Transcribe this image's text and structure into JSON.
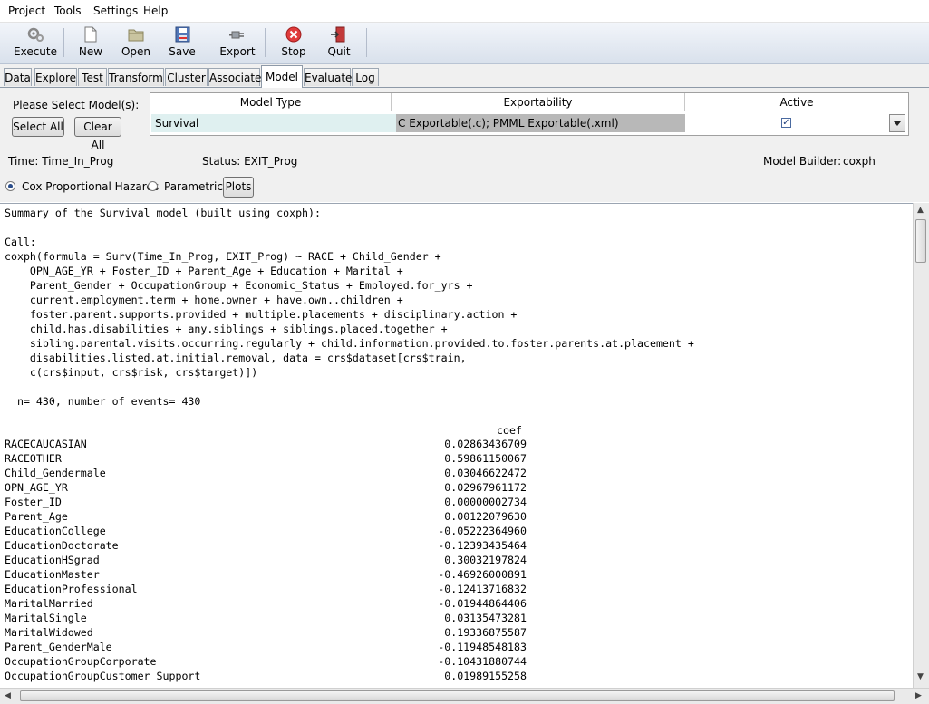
{
  "menu": [
    "Project",
    "Tools",
    "Settings",
    "Help"
  ],
  "toolbar": {
    "execute": "Execute",
    "new": "New",
    "open": "Open",
    "save": "Save",
    "export": "Export",
    "stop": "Stop",
    "quit": "Quit"
  },
  "tabs": [
    "Data",
    "Explore",
    "Test",
    "Transform",
    "Cluster",
    "Associate",
    "Model",
    "Evaluate",
    "Log"
  ],
  "active_tab": "Model",
  "model_select": {
    "prompt": "Please Select Model(s):",
    "select_all": "Select All",
    "clear_all": "Clear All"
  },
  "model_grid": {
    "headers": [
      "Model Type",
      "Exportability",
      "Active"
    ],
    "row": {
      "type": "Survival",
      "exportability": "C Exportable(.c); PMML Exportable(.xml)",
      "active": true
    }
  },
  "status": {
    "time": "Time: Time_In_Prog",
    "status": "Status: EXIT_Prog",
    "builder_label": "Model Builder:",
    "builder_value": "coxph"
  },
  "options": {
    "cox": "Cox Proportional Hazards",
    "parametric": "Parametric",
    "plots": "Plots",
    "selected": "cox"
  },
  "summary": {
    "header": "Summary of the Survival model (built using coxph):",
    "call_label": "Call:",
    "call_lines": [
      "coxph(formula = Surv(Time_In_Prog, EXIT_Prog) ~ RACE + Child_Gender +",
      "    OPN_AGE_YR + Foster_ID + Parent_Age + Education + Marital +",
      "    Parent_Gender + OccupationGroup + Economic_Status + Employed.for_yrs +",
      "    current.employment.term + home.owner + have.own..children +",
      "    foster.parent.supports.provided + multiple.placements + disciplinary.action +",
      "    child.has.disabilities + any.siblings + siblings.placed.together +",
      "    sibling.parental.visits.occurring.regularly + child.information.provided.to.foster.parents.at.placement +",
      "    disabilities.listed.at.initial.removal, data = crs$dataset[crs$train,",
      "    c(crs$input, crs$risk, crs$target)])"
    ],
    "n_line": "  n= 430, number of events= 430",
    "coef_header": "coef",
    "coefficients": [
      {
        "name": "RACECAUCASIAN",
        "coef": "0.02863436709"
      },
      {
        "name": "RACEOTHER",
        "coef": "0.59861150067"
      },
      {
        "name": "Child_Gendermale",
        "coef": "0.03046622472"
      },
      {
        "name": "OPN_AGE_YR",
        "coef": "0.02967961172"
      },
      {
        "name": "Foster_ID",
        "coef": "0.00000002734"
      },
      {
        "name": "Parent_Age",
        "coef": "0.00122079630"
      },
      {
        "name": "EducationCollege",
        "coef": "-0.05222364960"
      },
      {
        "name": "EducationDoctorate",
        "coef": "-0.12393435464"
      },
      {
        "name": "EducationHSgrad",
        "coef": "0.30032197824"
      },
      {
        "name": "EducationMaster",
        "coef": "-0.46926000891"
      },
      {
        "name": "EducationProfessional",
        "coef": "-0.12413716832"
      },
      {
        "name": "MaritalMarried",
        "coef": "-0.01944864406"
      },
      {
        "name": "MaritalSingle",
        "coef": "0.03135473281"
      },
      {
        "name": "MaritalWidowed",
        "coef": "0.19336875587"
      },
      {
        "name": "Parent_GenderMale",
        "coef": "-0.11948548183"
      },
      {
        "name": "OccupationGroupCorporate",
        "coef": "-0.10431880744"
      },
      {
        "name": "OccupationGroupCustomer Support",
        "coef": "0.01989155258"
      }
    ]
  },
  "icons": {
    "execute": "gears-icon",
    "new": "new-document-icon",
    "open": "open-folder-icon",
    "save": "floppy-disk-icon",
    "export": "export-plug-icon",
    "stop": "stop-icon",
    "quit": "exit-door-icon"
  },
  "colors": {
    "toolbar_top": "#f2f5fa",
    "toolbar_bottom": "#d9e1ec",
    "row_highlight": "#dff0f0",
    "export_cell": "#b8b8b8",
    "stop_red": "#e03b3b"
  }
}
